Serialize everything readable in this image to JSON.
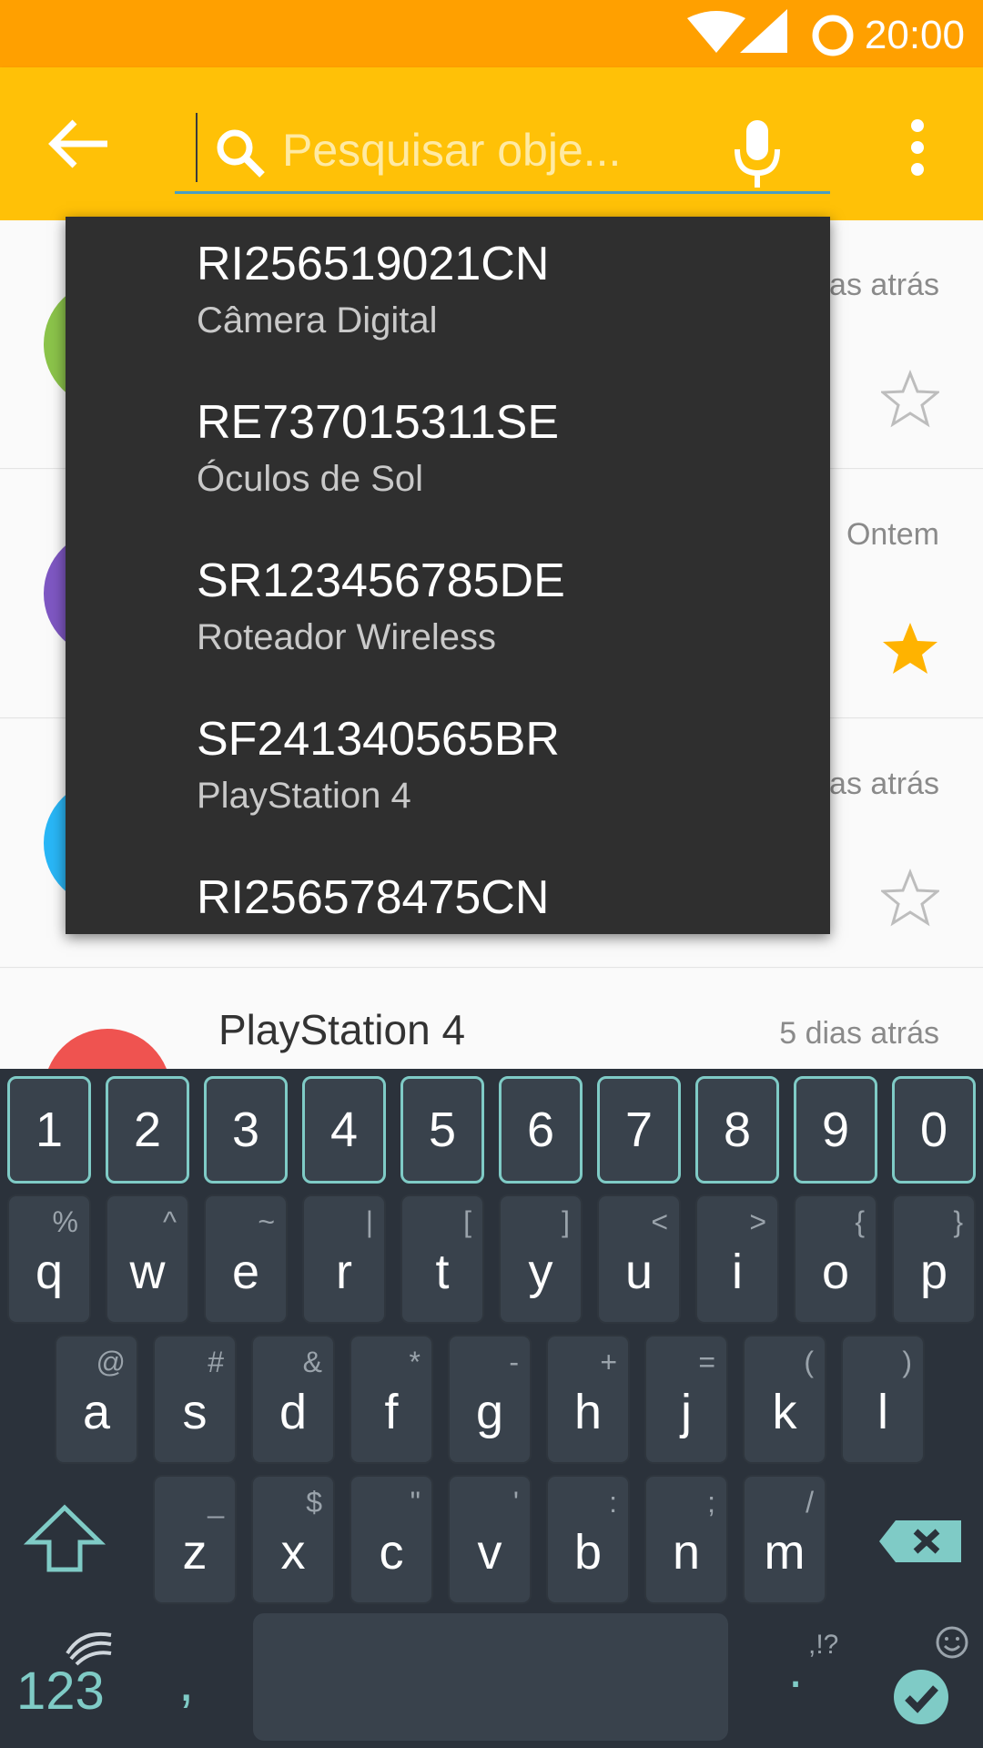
{
  "status_bar": {
    "time": "20:00"
  },
  "toolbar": {
    "search_placeholder": "Pesquisar obje..."
  },
  "list_rows": [
    {
      "time": "...as atrás",
      "starred": false,
      "avatar_color": "#8BC34A"
    },
    {
      "time": "Ontem",
      "starred": true,
      "avatar_color": "#7E57C2"
    },
    {
      "time": "...as atrás",
      "starred": false,
      "avatar_color": "#29B6F6"
    },
    {
      "title": "PlayStation 4",
      "time": "5 dias atrás",
      "avatar_color": "#EF5350"
    }
  ],
  "suggestions": [
    {
      "code": "RI256519021CN",
      "name": "Câmera Digital"
    },
    {
      "code": "RE737015311SE",
      "name": "Óculos de Sol"
    },
    {
      "code": "SR123456785DE",
      "name": "Roteador Wireless"
    },
    {
      "code": "SF241340565BR",
      "name": "PlayStation 4"
    },
    {
      "code": "RI256578475CN",
      "name": ""
    }
  ],
  "keyboard": {
    "numbers": [
      "1",
      "2",
      "3",
      "4",
      "5",
      "6",
      "7",
      "8",
      "9",
      "0"
    ],
    "row1": [
      [
        "q",
        "%"
      ],
      [
        "w",
        "^"
      ],
      [
        "e",
        "~"
      ],
      [
        "r",
        "|"
      ],
      [
        "t",
        "["
      ],
      [
        "y",
        "]"
      ],
      [
        "u",
        "<"
      ],
      [
        "i",
        ">"
      ],
      [
        "o",
        "{"
      ],
      [
        "p",
        "}"
      ]
    ],
    "row2": [
      [
        "a",
        "@"
      ],
      [
        "s",
        "#"
      ],
      [
        "d",
        "&"
      ],
      [
        "f",
        "*"
      ],
      [
        "g",
        "-"
      ],
      [
        "h",
        "+"
      ],
      [
        "j",
        "="
      ],
      [
        "k",
        "("
      ],
      [
        "l",
        ")"
      ]
    ],
    "row3": [
      [
        "z",
        "_"
      ],
      [
        "x",
        "$"
      ],
      [
        "c",
        "\""
      ],
      [
        "v",
        "'"
      ],
      [
        "b",
        ":"
      ],
      [
        "n",
        ";"
      ],
      [
        "m",
        "/"
      ]
    ],
    "mode_label": "123",
    "comma": ",",
    "period": ".",
    "punct_hint": ",!?"
  },
  "colors": {
    "status_bar": "#FFA000",
    "toolbar": "#FFC107",
    "accent": "#7fcbc6",
    "star": "#FFB300"
  }
}
